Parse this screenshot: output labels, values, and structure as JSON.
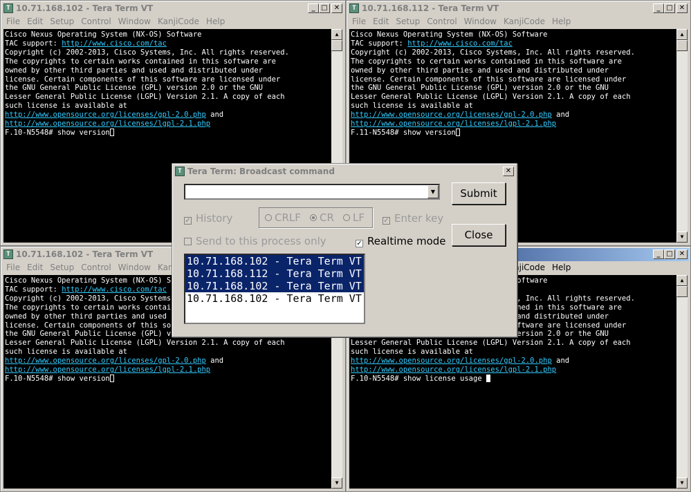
{
  "windows": [
    {
      "title": "10.71.168.102 - Tera Term VT",
      "active": false,
      "prompt": "F.10-N5548# ",
      "command": "show version",
      "cursor": "outline"
    },
    {
      "title": "10.71.168.112 - Tera Term VT",
      "active": false,
      "prompt": "F.11-N5548# ",
      "command": "show version",
      "cursor": "outline"
    },
    {
      "title": "10.71.168.102 - Tera Term VT",
      "active": false,
      "prompt": "F.10-N5548# ",
      "command": "show version",
      "cursor": "outline"
    },
    {
      "title": "10.71.168.102 - Tera Term VT",
      "active": true,
      "prompt": "F.10-N5548# ",
      "command": "show license usage ",
      "cursor": "solid"
    }
  ],
  "menu": [
    "File",
    "Edit",
    "Setup",
    "Control",
    "Window",
    "KanjiCode",
    "Help"
  ],
  "banner": {
    "line1": "Cisco Nexus Operating System (NX-OS) Software",
    "tac_label": "TAC support: ",
    "tac_url": "http://www.cisco.com/tac",
    "line3": "Copyright (c) 2002-2013, Cisco Systems, Inc. All rights reserved.",
    "line4": "The copyrights to certain works contained in this software are",
    "line5": "owned by other third parties and used and distributed under",
    "line6": "license. Certain components of this software are licensed under",
    "line7": "the GNU General Public License (GPL) version 2.0 or the GNU",
    "line8": "Lesser General Public License (LGPL) Version 2.1. A copy of each",
    "line9": "such license is available at",
    "gpl_url": "http://www.opensource.org/licenses/gpl-2.0.php",
    "and": " and",
    "lgpl_url": "http://www.opensource.org/licenses/lgpl-2.1.php"
  },
  "dialog": {
    "title": "Tera Term: Broadcast command",
    "submit_label": "Submit",
    "close_label": "Close",
    "history_label": "History",
    "crlf_label": "CRLF",
    "cr_label": "CR",
    "lf_label": "LF",
    "enter_key_label": "Enter key",
    "send_process_label": "Send to this process only",
    "realtime_label": "Realtime mode",
    "list": [
      {
        "label": "10.71.168.102 - Tera Term VT",
        "selected": true
      },
      {
        "label": "10.71.168.112 - Tera Term VT",
        "selected": true
      },
      {
        "label": "10.71.168.102 - Tera Term VT",
        "selected": true
      },
      {
        "label": "10.71.168.102 - Tera Term VT",
        "selected": false
      }
    ]
  },
  "colors": {
    "active_title": "#0a246a",
    "link": "#33ccff",
    "terminal_bg": "#000000"
  }
}
